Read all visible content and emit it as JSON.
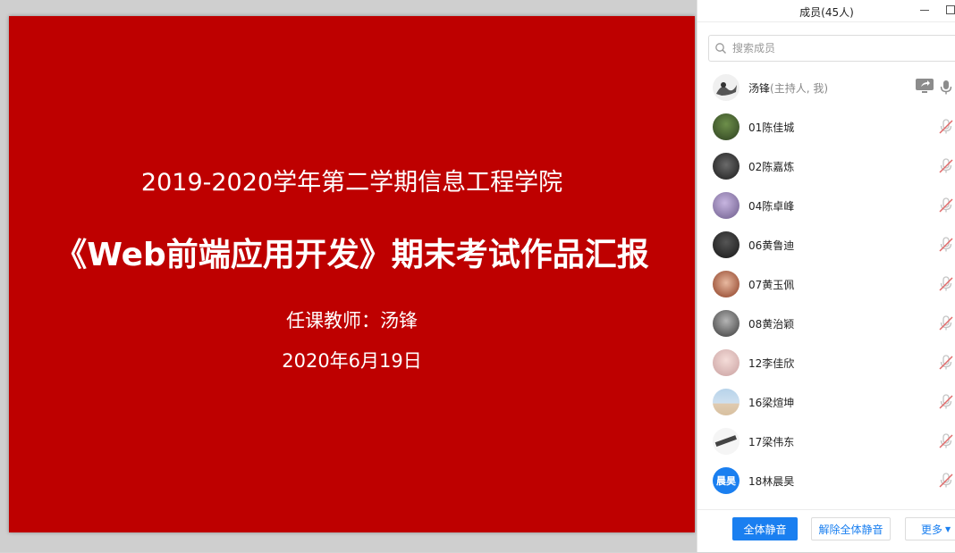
{
  "slide": {
    "subtitle": "2019-2020学年第二学期信息工程学院",
    "title": "《Web前端应用开发》期末考试作品汇报",
    "teacher": "任课教师：汤锋",
    "date": "2020年6月19日",
    "background_color": "#be0000"
  },
  "panel": {
    "title": "成员(45人)",
    "search_placeholder": "搜索成员",
    "host": {
      "name": "汤锋",
      "role": "(主持人, 我)"
    },
    "members": [
      {
        "name": "01陈佳城",
        "avatar": ""
      },
      {
        "name": "02陈嘉炼",
        "avatar": ""
      },
      {
        "name": "04陈卓峰",
        "avatar": ""
      },
      {
        "name": "06黄鲁迪",
        "avatar": ""
      },
      {
        "name": "07黄玉佩",
        "avatar": ""
      },
      {
        "name": "08黄治颖",
        "avatar": ""
      },
      {
        "name": "12李佳欣",
        "avatar": ""
      },
      {
        "name": "16梁煊坤",
        "avatar": ""
      },
      {
        "name": "17梁伟东",
        "avatar": ""
      },
      {
        "name": "18林晨昊",
        "avatar": "晨昊"
      }
    ],
    "footer": {
      "mute_all": "全体静音",
      "unmute_all": "解除全体静音",
      "more": "更多"
    },
    "accent_color": "#1a7ff0",
    "muted_mic_color": "#e06a6a"
  }
}
